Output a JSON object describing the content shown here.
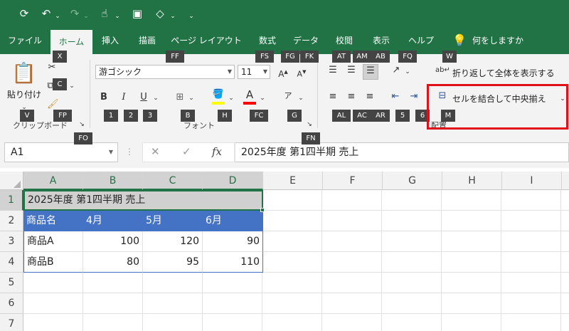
{
  "quick_access": {
    "redo_dropdown": "⌄",
    "undo_dropdown": "⌄",
    "customize": "⌄"
  },
  "tabs": [
    "ファイル",
    "ホーム",
    "挿入",
    "描画",
    "ページ レイアウト",
    "数式",
    "データ",
    "校閲",
    "表示",
    "ヘルプ"
  ],
  "tell_me": "何をしますか",
  "keytips": {
    "X": "X",
    "FF": "FF",
    "FS": "FS",
    "FG": "FG",
    "FK": "FK",
    "AT": "AT",
    "AM": "AM",
    "AB": "AB",
    "FQ": "FQ",
    "W": "W",
    "C": "C",
    "V": "V",
    "FP": "FP",
    "FO": "FO",
    "B_bold": "1",
    "I_italic": "2",
    "U_underline": "3",
    "borders": "B",
    "fill": "H",
    "fontcolor": "FC",
    "phonetic": "G",
    "FN": "FN",
    "AL": "AL",
    "AC": "AC",
    "AR": "AR",
    "indent_dec": "5",
    "indent_inc": "6",
    "M": "M"
  },
  "clipboard": {
    "paste_label": "貼り付け",
    "group_label": "クリップボード"
  },
  "font": {
    "name": "游ゴシック",
    "size": "11",
    "group_label": "フォント",
    "bold": "B",
    "italic": "I",
    "underline": "U"
  },
  "alignment": {
    "wrap_text": "折り返して全体を表示する",
    "merge_center": "セルを結合して中央揃え",
    "group_label": "配置"
  },
  "formula_bar": {
    "name_box": "A1",
    "fx": "fx",
    "content": "2025年度 第1四半期 売上"
  },
  "grid": {
    "columns": [
      "A",
      "B",
      "C",
      "D",
      "E",
      "F",
      "G",
      "H",
      "I"
    ],
    "rows": [
      "1",
      "2",
      "3",
      "4",
      "5",
      "6",
      "7"
    ],
    "a1": "2025年度 第1四半期 売上",
    "header_row": [
      "商品名",
      "4月",
      "5月",
      "6月"
    ],
    "data_rows": [
      {
        "name": "商品A",
        "values": [
          "100",
          "120",
          "90"
        ]
      },
      {
        "name": "商品B",
        "values": [
          "80",
          "95",
          "110"
        ]
      }
    ]
  },
  "colors": {
    "excel_green": "#217346",
    "header_fill": "#4472c4",
    "highlight_red": "#e0101b",
    "keytip_bg": "#444444"
  }
}
